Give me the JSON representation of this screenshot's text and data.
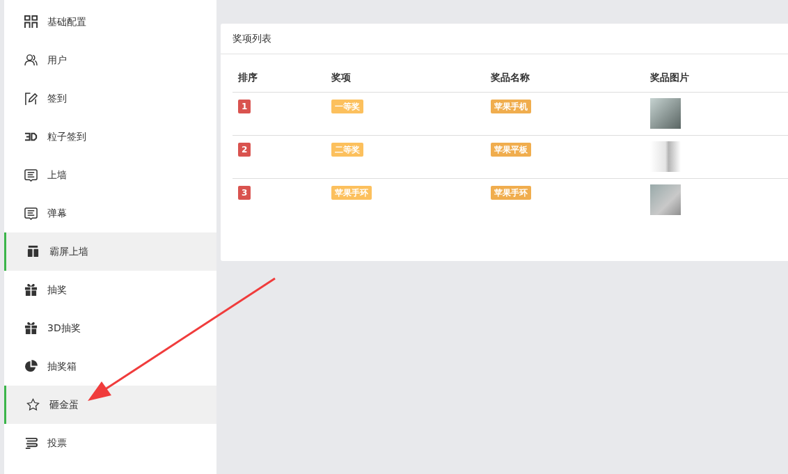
{
  "sidebar": {
    "items": [
      {
        "label": "基础配置",
        "selected": false
      },
      {
        "label": "用户",
        "selected": false
      },
      {
        "label": "签到",
        "selected": false
      },
      {
        "label": "粒子签到",
        "selected": false
      },
      {
        "label": "上墙",
        "selected": false
      },
      {
        "label": "弹幕",
        "selected": false
      },
      {
        "label": "霸屏上墙",
        "selected": true
      },
      {
        "label": "抽奖",
        "selected": false
      },
      {
        "label": "3D抽奖",
        "selected": false
      },
      {
        "label": "抽奖箱",
        "selected": false
      },
      {
        "label": "砸金蛋",
        "selected": true
      },
      {
        "label": "投票",
        "selected": false
      }
    ]
  },
  "panel": {
    "title": "奖项列表",
    "table": {
      "columns": [
        "排序",
        "奖项",
        "奖品名称",
        "奖品图片"
      ],
      "rows": [
        {
          "rank": "1",
          "prize": "一等奖",
          "name": "苹果手机"
        },
        {
          "rank": "2",
          "prize": "二等奖",
          "name": "苹果平板"
        },
        {
          "rank": "3",
          "prize": "苹果手环",
          "name": "苹果手环"
        }
      ]
    }
  }
}
